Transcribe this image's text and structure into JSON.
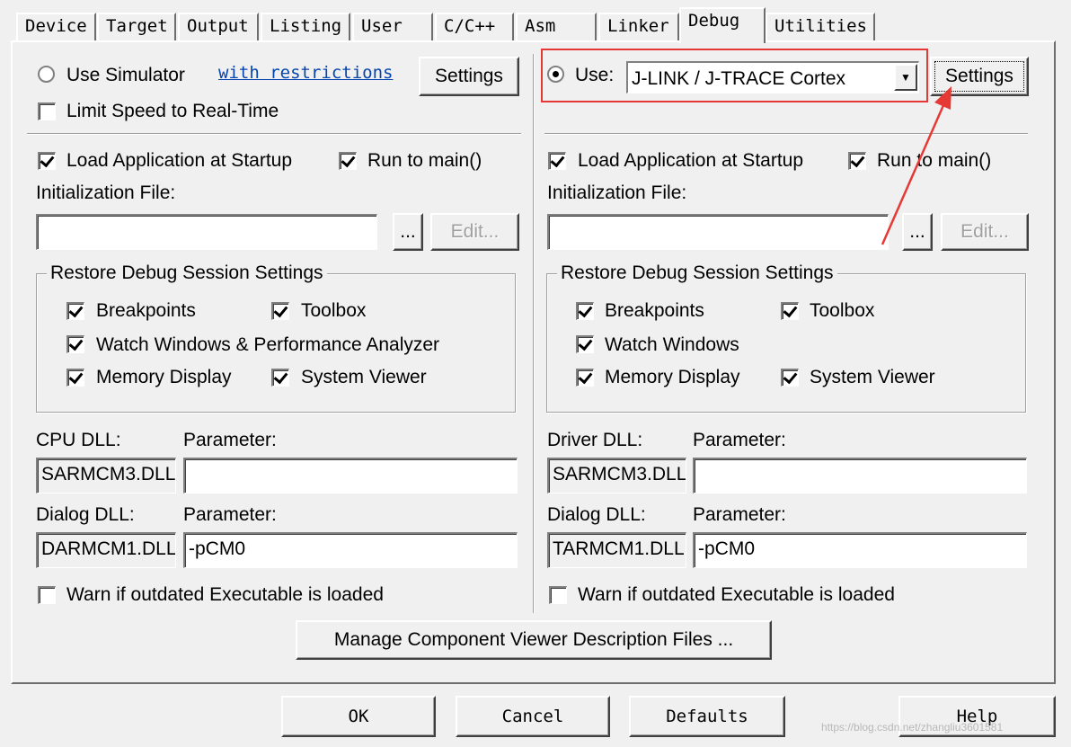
{
  "tabs": [
    "Device",
    "Target",
    "Output",
    "Listing",
    "User",
    "C/C++",
    "Asm",
    "Linker",
    "Debug",
    "Utilities"
  ],
  "active_tab": "Debug",
  "left": {
    "use_simulator_label": "Use Simulator",
    "use_simulator_checked": false,
    "restrictions_link": "with restrictions",
    "settings_label": "Settings",
    "limit_speed_label": "Limit Speed to Real-Time",
    "limit_speed_checked": false,
    "load_app_label": "Load Application at Startup",
    "load_app_checked": true,
    "run_main_label": "Run to main()",
    "run_main_checked": true,
    "init_file_label": "Initialization File:",
    "init_file_value": "",
    "browse_label": "...",
    "edit_label": "Edit...",
    "restore_title": "Restore Debug Session Settings",
    "breakpoints_label": "Breakpoints",
    "toolbox_label": "Toolbox",
    "watch_label": "Watch Windows & Performance Analyzer",
    "memory_label": "Memory Display",
    "sysviewer_label": "System Viewer",
    "cpu_dll_label": "CPU DLL:",
    "cpu_param_label": "Parameter:",
    "cpu_dll_value": "SARMCM3.DLL",
    "cpu_param_value": "",
    "dialog_dll_label": "Dialog DLL:",
    "dialog_param_label": "Parameter:",
    "dialog_dll_value": "DARMCM1.DLL",
    "dialog_param_value": "-pCM0",
    "warn_label": "Warn if outdated Executable is loaded",
    "warn_checked": false
  },
  "right": {
    "use_label": "Use:",
    "use_checked": true,
    "driver_selected": "J-LINK / J-TRACE Cortex",
    "settings_label": "Settings",
    "load_app_label": "Load Application at Startup",
    "load_app_checked": true,
    "run_main_label": "Run to main()",
    "run_main_checked": true,
    "init_file_label": "Initialization File:",
    "init_file_value": "",
    "browse_label": "...",
    "edit_label": "Edit...",
    "restore_title": "Restore Debug Session Settings",
    "breakpoints_label": "Breakpoints",
    "toolbox_label": "Toolbox",
    "watch_label": "Watch Windows",
    "memory_label": "Memory Display",
    "sysviewer_label": "System Viewer",
    "driver_dll_label": "Driver DLL:",
    "driver_param_label": "Parameter:",
    "driver_dll_value": "SARMCM3.DLL",
    "driver_param_value": "",
    "dialog_dll_label": "Dialog DLL:",
    "dialog_param_label": "Parameter:",
    "dialog_dll_value": "TARMCM1.DLL",
    "dialog_param_value": "-pCM0",
    "warn_label": "Warn if outdated Executable is loaded",
    "warn_checked": false
  },
  "manage_button": "Manage Component Viewer Description Files ...",
  "footer": {
    "ok": "OK",
    "cancel": "Cancel",
    "defaults": "Defaults",
    "help": "Help"
  },
  "watermark": "https://blog.csdn.net/zhangliu3601581",
  "colors": {
    "highlight": "#e53935",
    "link": "#0645ad",
    "dialog_bg": "#f0f0f0"
  }
}
